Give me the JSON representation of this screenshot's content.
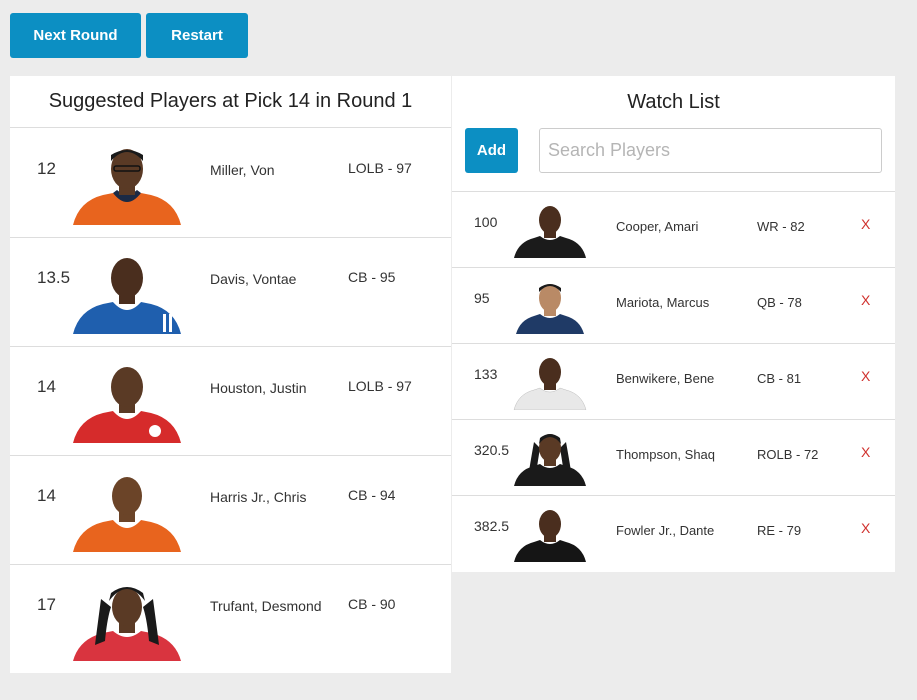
{
  "toolbar": {
    "next_round_label": "Next Round",
    "restart_label": "Restart"
  },
  "suggested": {
    "title": "Suggested Players at Pick 14 in Round 1",
    "players": [
      {
        "rank": "12",
        "name": "Miller, Von",
        "pos": "LOLB - 97",
        "photo": "player-photo"
      },
      {
        "rank": "13.5",
        "name": "Davis, Vontae",
        "pos": "CB - 95",
        "photo": "player-photo"
      },
      {
        "rank": "14",
        "name": "Houston, Justin",
        "pos": "LOLB - 97",
        "photo": "player-photo"
      },
      {
        "rank": "14",
        "name": "Harris Jr., Chris",
        "pos": "CB - 94",
        "photo": "player-photo"
      },
      {
        "rank": "17",
        "name": "Trufant, Desmond",
        "pos": "CB - 90",
        "photo": "player-photo"
      }
    ]
  },
  "watch": {
    "title": "Watch List",
    "add_label": "Add",
    "search_placeholder": "Search Players",
    "search_value": "",
    "remove_label": "X",
    "players": [
      {
        "rank": "100",
        "name": "Cooper, Amari",
        "pos": "WR - 82",
        "photo": "player-photo"
      },
      {
        "rank": "95",
        "name": "Mariota, Marcus",
        "pos": "QB - 78",
        "photo": "player-photo"
      },
      {
        "rank": "133",
        "name": "Benwikere, Bene",
        "pos": "CB - 81",
        "photo": "player-photo"
      },
      {
        "rank": "320.5",
        "name": "Thompson, Shaq",
        "pos": "ROLB - 72",
        "photo": "player-photo"
      },
      {
        "rank": "382.5",
        "name": "Fowler Jr., Dante",
        "pos": "RE - 79",
        "photo": "player-photo"
      }
    ]
  },
  "colors": {
    "accent": "#0c8fc3",
    "remove": "#d0312d",
    "jerseys": [
      "#e8641e",
      "#1f5fae",
      "#d62b2b",
      "#e8641e",
      "#d9343f"
    ],
    "watch_jerseys": [
      "#1b1b1b",
      "#1f3a66",
      "#e8e8e8",
      "#1a1a1a",
      "#151515"
    ]
  }
}
